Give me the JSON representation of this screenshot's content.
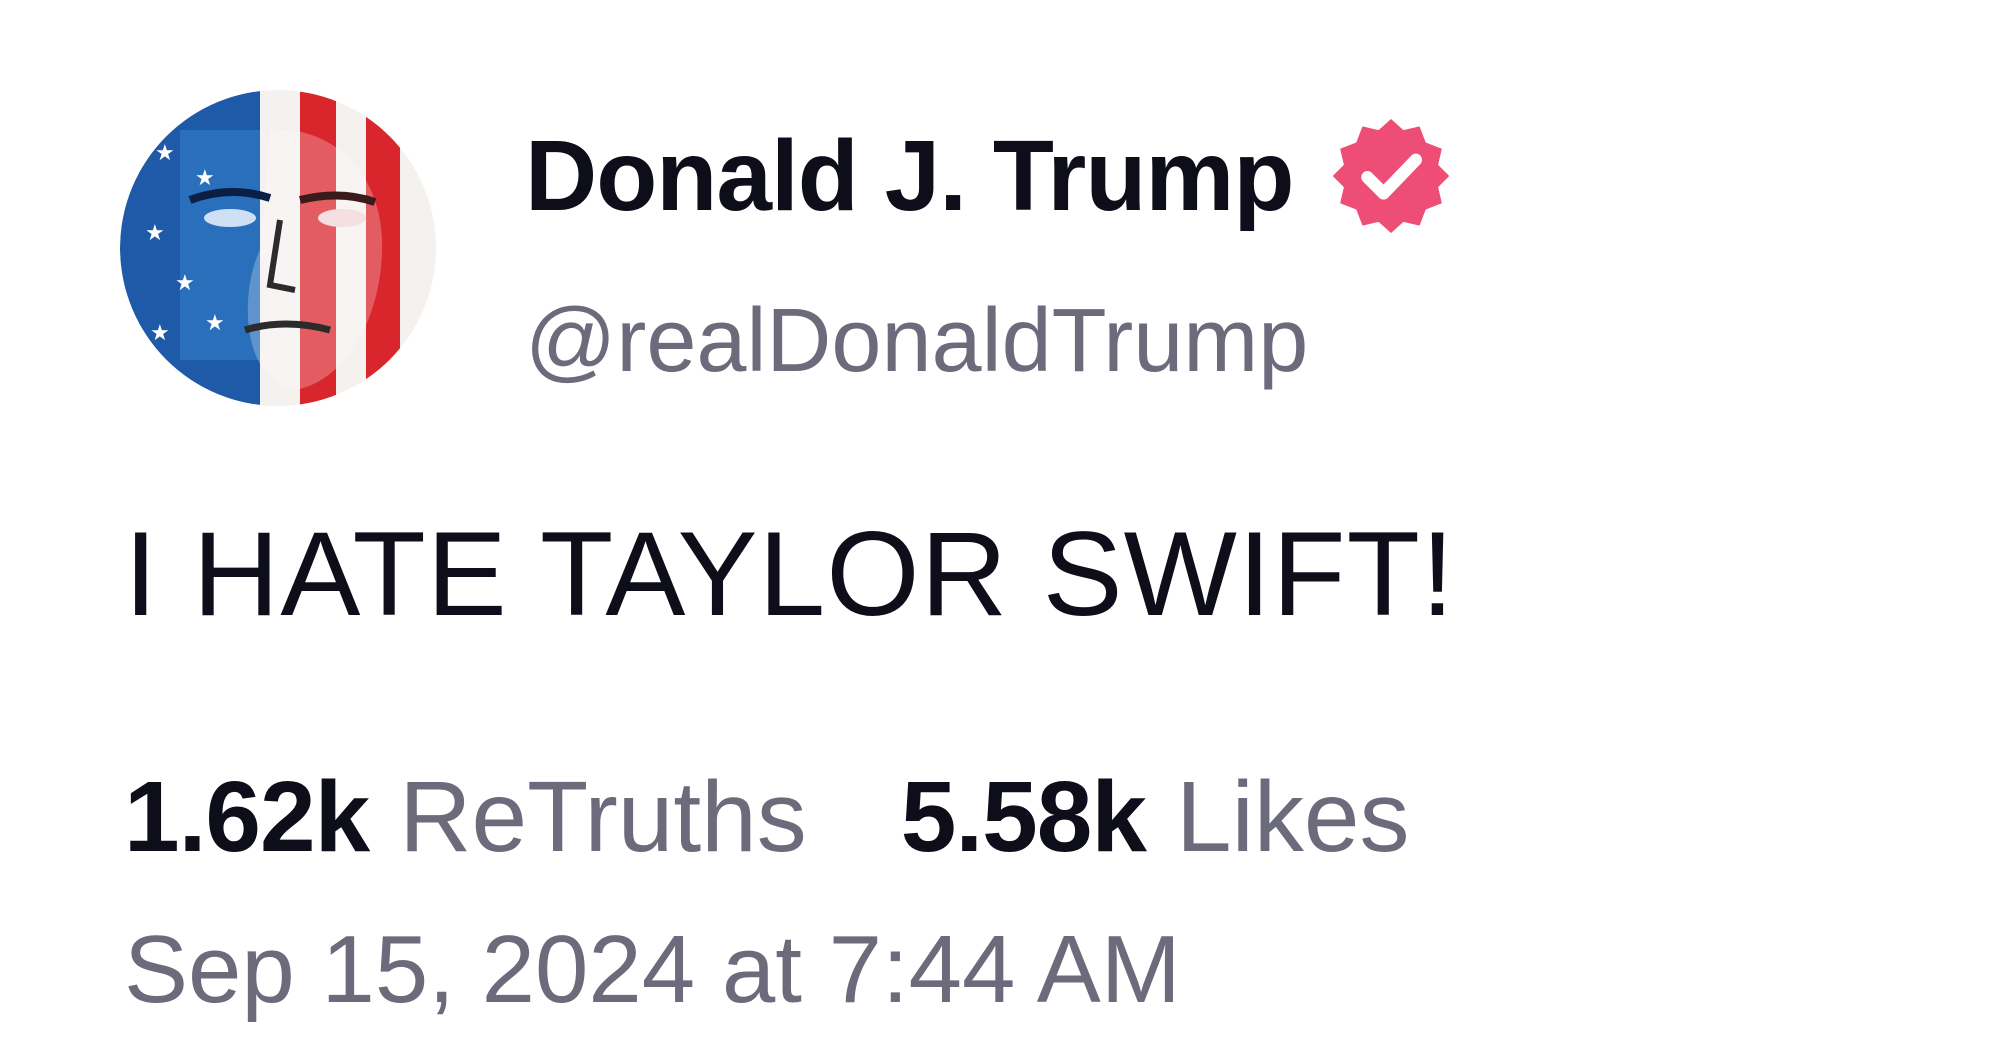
{
  "post": {
    "author": {
      "display_name": "Donald J. Trump",
      "handle": "@realDonaldTrump",
      "verified": true,
      "verified_badge_icon": "verified-badge-icon",
      "avatar_icon": "avatar-flag-portrait"
    },
    "text": "I HATE TAYLOR SWIFT!",
    "stats": {
      "retruths_count": "1.62k",
      "retruths_label": "ReTruths",
      "likes_count": "5.58k",
      "likes_label": "Likes"
    },
    "timestamp": "Sep 15, 2024 at 7:44 AM"
  },
  "colors": {
    "text_primary": "#0e0e1a",
    "text_secondary": "#6b6b7b",
    "verified_badge": "#ee4d76",
    "flag_red": "#d9262c",
    "flag_blue": "#1f5aa8"
  }
}
